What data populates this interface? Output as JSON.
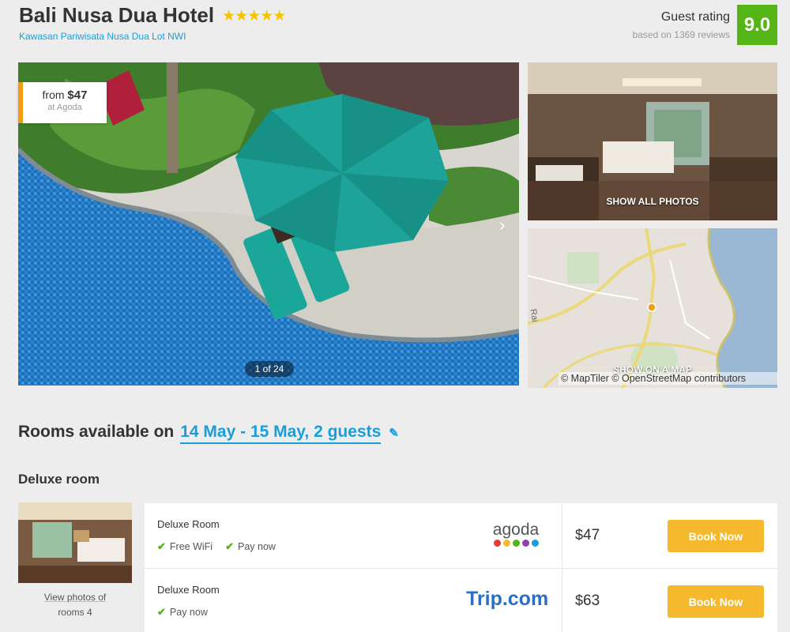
{
  "header": {
    "hotel_name": "Bali Nusa Dua Hotel",
    "stars": "★★★★★",
    "address": "Kawasan Pariwisata Nusa Dua Lot NWI",
    "rating_label": "Guest rating",
    "rating_reviews": "based on 1369 reviews",
    "rating_score": "9.0"
  },
  "gallery": {
    "price_from": "from ",
    "price_value": "$47",
    "price_source": "at Agoda",
    "counter": "1 of 24",
    "show_photos": "SHOW ALL PHOTOS",
    "show_map": "SHOW ON A MAP",
    "map_credit": "© MapTiler © OpenStreetMap contributors",
    "map_label": "Rai"
  },
  "rooms": {
    "heading_prefix": "Rooms available on",
    "heading_dates": "14 May - 15 May, 2 guests",
    "room_type": "Deluxe room",
    "view_photos_line1": "View photos of",
    "view_photos_line2": "rooms 4",
    "offers": [
      {
        "name": "Deluxe Room",
        "features": [
          "Free WiFi",
          "Pay now"
        ],
        "provider": "agoda",
        "currency": "$",
        "price": "47",
        "button": "Book Now"
      },
      {
        "name": "Deluxe Room",
        "features": [
          "Pay now"
        ],
        "provider": "Trip.com",
        "currency": "$",
        "price": "63",
        "button": "Book Now"
      }
    ]
  },
  "colors": {
    "accent_blue": "#1a9ed9",
    "rating_green": "#55b416",
    "book_orange": "#f6b92e",
    "price_tag_orange": "#f39c12",
    "agoda_dots": [
      "#e53935",
      "#f6b92e",
      "#55b416",
      "#8e44ad",
      "#1a9ed9"
    ]
  }
}
